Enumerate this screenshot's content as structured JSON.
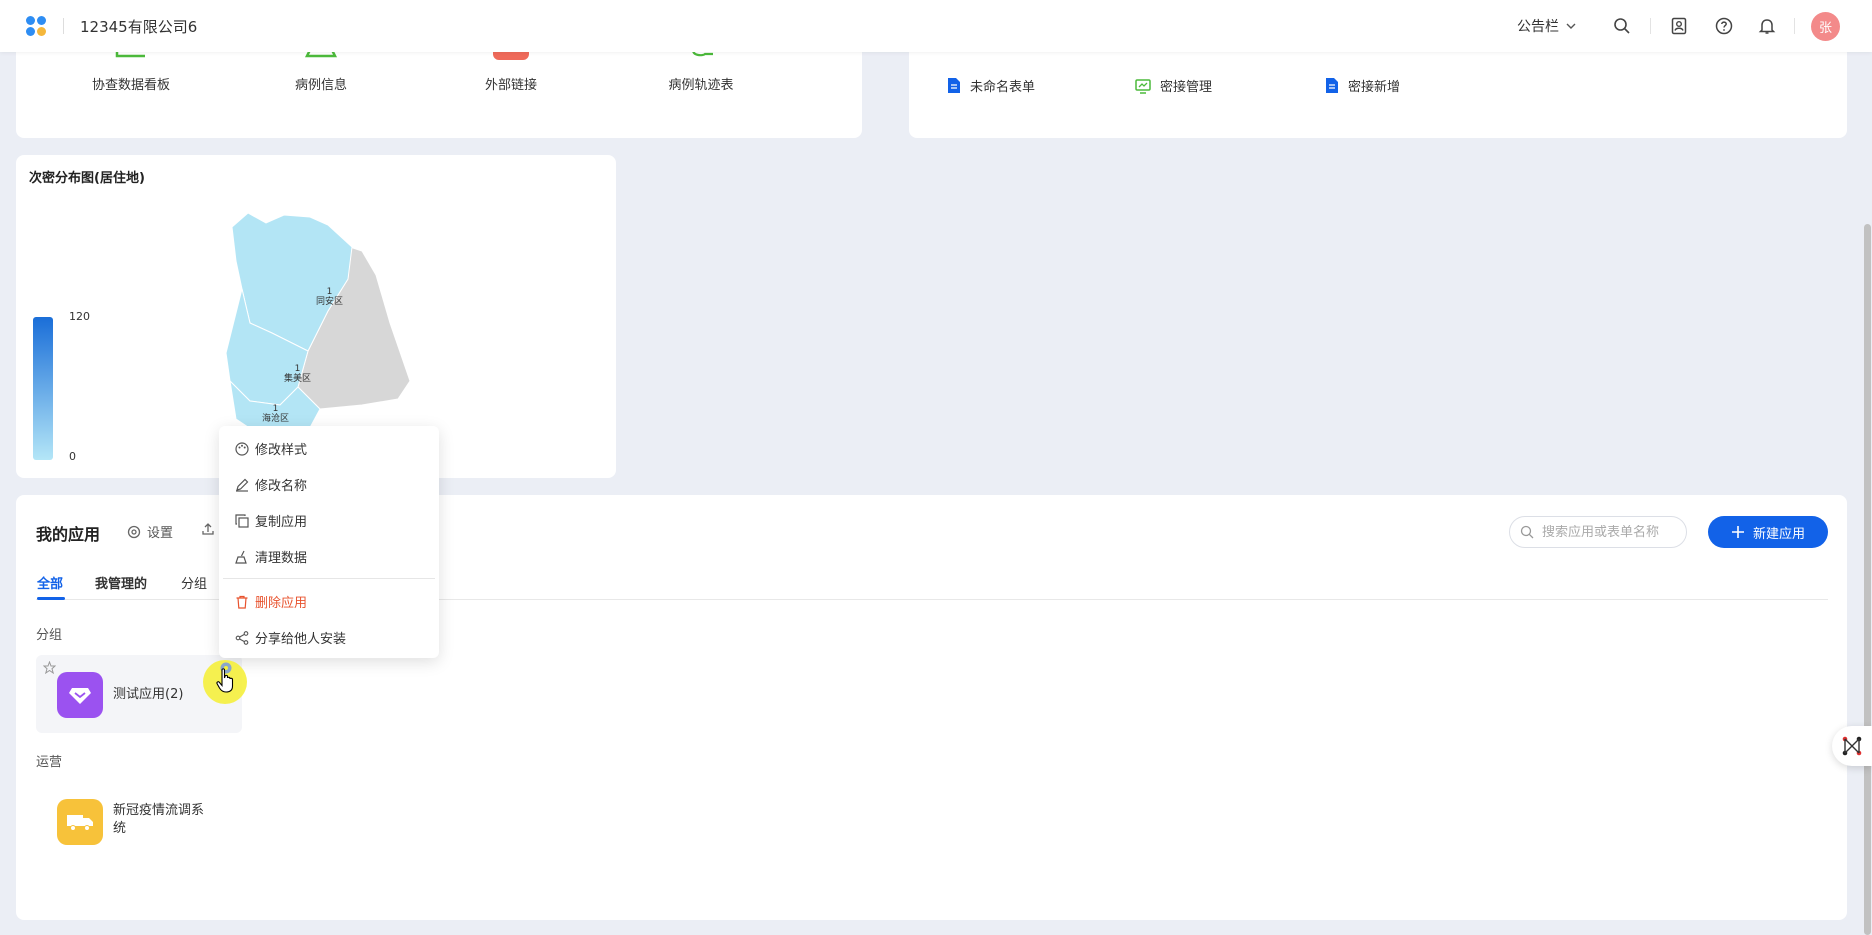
{
  "header": {
    "company": "12345有限公司6",
    "notice_label": "公告栏",
    "avatar_text": "张"
  },
  "shortcuts": [
    {
      "label": "协查数据看板",
      "color": "#4cba3b"
    },
    {
      "label": "病例信息",
      "color": "#4cba3b"
    },
    {
      "label": "外部链接",
      "color": "#ef6a5a"
    },
    {
      "label": "病例轨迹表",
      "color": "#4cba3b"
    }
  ],
  "forms": [
    {
      "label": "未命名表单",
      "icon": "document-icon"
    },
    {
      "label": "密接管理",
      "icon": "screen-icon"
    },
    {
      "label": "密接新增",
      "icon": "document-icon"
    }
  ],
  "map": {
    "title": "次密分布图(居住地)",
    "legend_max": "120",
    "legend_min": "0",
    "regions": [
      {
        "name": "同安区",
        "value": "1"
      },
      {
        "name": "集美区",
        "value": "1"
      },
      {
        "name": "海沧区",
        "value": "1"
      }
    ]
  },
  "apps_section": {
    "title": "我的应用",
    "settings_label": "设置",
    "search_placeholder": "搜索应用或表单名称",
    "new_app_label": "新建应用",
    "tabs": [
      "全部",
      "我管理的",
      "分组"
    ],
    "groups": [
      {
        "label": "分组",
        "app_name": "测试应用(2)",
        "icon_color": "#9b52f0"
      },
      {
        "label": "运营",
        "app_name_line1": "新冠疫情流调系",
        "app_name_line2": "统",
        "icon_color": "#f7c23a"
      }
    ]
  },
  "context_menu": {
    "items": [
      "修改样式",
      "修改名称",
      "复制应用",
      "清理数据",
      "删除应用",
      "分享给他人安装"
    ]
  },
  "colors": {
    "primary": "#1262e8",
    "danger": "#e8532e"
  }
}
